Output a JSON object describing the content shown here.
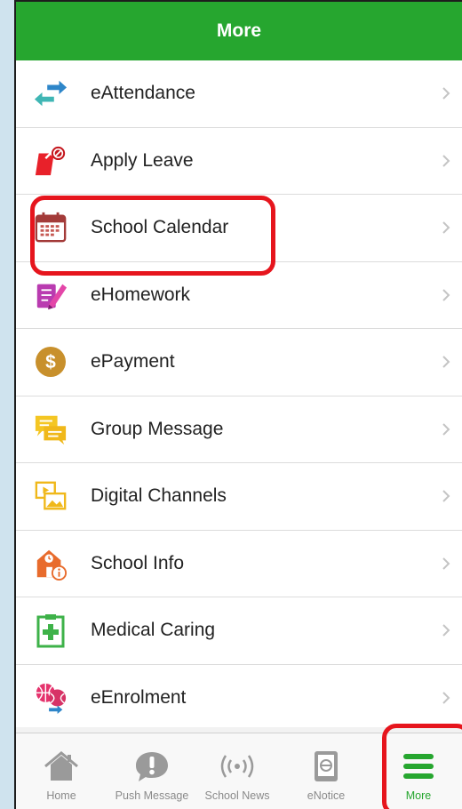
{
  "header": {
    "title": "More"
  },
  "menu": {
    "items": [
      {
        "label": "eAttendance",
        "icon": "arrows-exchange-icon"
      },
      {
        "label": "Apply Leave",
        "icon": "leave-form-icon"
      },
      {
        "label": "School Calendar",
        "icon": "calendar-icon"
      },
      {
        "label": "eHomework",
        "icon": "homework-pencil-icon"
      },
      {
        "label": "ePayment",
        "icon": "dollar-coin-icon"
      },
      {
        "label": "Group Message",
        "icon": "chat-bubbles-icon"
      },
      {
        "label": "Digital Channels",
        "icon": "media-channels-icon"
      },
      {
        "label": "School Info",
        "icon": "school-info-icon"
      },
      {
        "label": "Medical Caring",
        "icon": "medical-clipboard-icon"
      },
      {
        "label": "eEnrolment",
        "icon": "enrolment-balls-icon"
      }
    ]
  },
  "tabbar": {
    "tabs": [
      {
        "label": "Home",
        "icon": "home-icon"
      },
      {
        "label": "Push Message",
        "icon": "push-message-icon"
      },
      {
        "label": "School News",
        "icon": "broadcast-icon"
      },
      {
        "label": "eNotice",
        "icon": "notice-icon"
      },
      {
        "label": "More",
        "icon": "menu-bars-icon",
        "active": true
      }
    ]
  },
  "colors": {
    "header_green": "#26a62f",
    "highlight_red": "#e6151d",
    "background_blue": "#cfe3ee"
  }
}
